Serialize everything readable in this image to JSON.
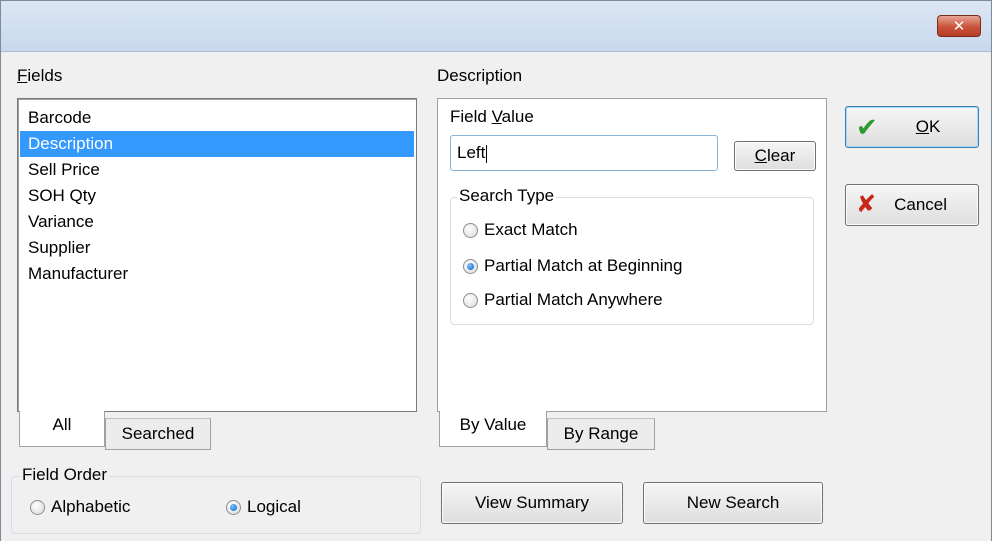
{
  "window": {
    "close_icon": "close-icon"
  },
  "fields": {
    "label": "Fields",
    "items": [
      "Barcode",
      "Description",
      "Sell Price",
      "SOH Qty",
      "Variance",
      "Supplier",
      "Manufacturer"
    ],
    "selected_index": 1,
    "tabs": [
      "All",
      "Searched"
    ],
    "active_tab": "All"
  },
  "field_order": {
    "title": "Field Order",
    "options": [
      "Alphabetic",
      "Logical"
    ],
    "selected": "Logical"
  },
  "description_panel": {
    "title": "Description",
    "field_value_label": "Field Value",
    "field_value": "Left",
    "clear_label": "Clear",
    "search_type": {
      "title": "Search Type",
      "options": [
        "Exact Match",
        "Partial Match at Beginning",
        "Partial Match Anywhere"
      ],
      "selected": "Partial Match at Beginning"
    },
    "tabs": [
      "By Value",
      "By Range"
    ],
    "active_tab": "By Value"
  },
  "buttons": {
    "ok": "OK",
    "cancel": "Cancel",
    "view_summary": "View Summary",
    "new_search": "New Search"
  },
  "colors": {
    "selection": "#3399ff",
    "ok_check": "#2e9a2e",
    "cancel_x": "#c8271b",
    "close_button": "#c8533a"
  }
}
